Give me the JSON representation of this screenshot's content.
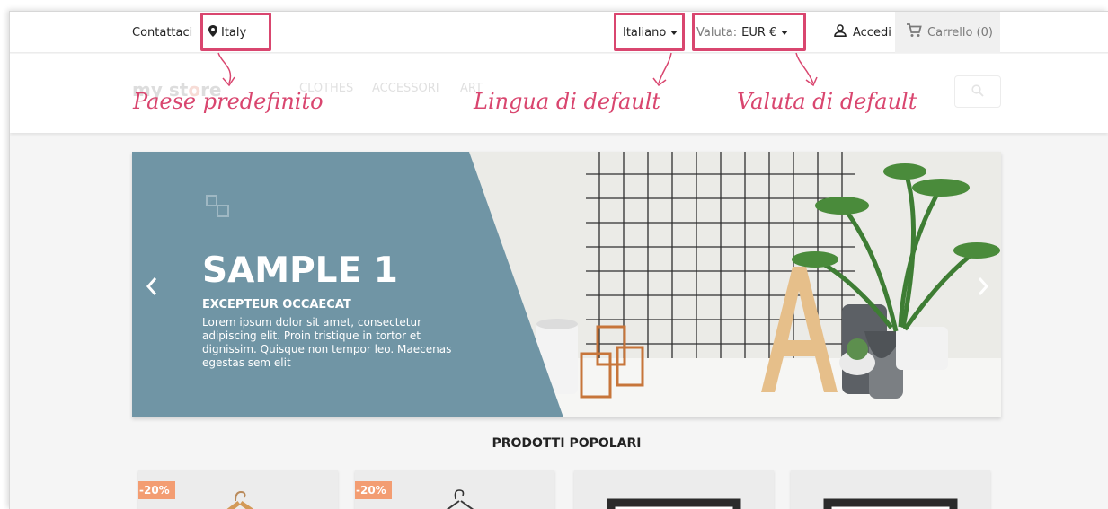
{
  "topbar": {
    "contact_label": "Contattaci",
    "country": "Italy",
    "language": "Italiano",
    "currency_label": "Valuta:",
    "currency_value": "EUR €",
    "signin_label": "Accedi",
    "cart_label": "Carrello (0)"
  },
  "header": {
    "logo_text_a": "my st",
    "logo_text_b": "o",
    "logo_text_c": "re",
    "menu": [
      "CLOTHES",
      "ACCESSORI",
      "ART"
    ]
  },
  "annotations": {
    "country": "Paese predefinito",
    "language": "Lingua di default",
    "currency": "Valuta di default"
  },
  "slider": {
    "title": "SAMPLE 1",
    "subtitle": "EXCEPTEUR OCCAECAT",
    "body": "Lorem ipsum dolor sit amet, consectetur adipiscing elit. Proin tristique in tortor et dignissim. Quisque non tempor leo. Maecenas egestas sem elit"
  },
  "section_title": "PRODOTTI POPOLARI",
  "products": [
    {
      "flag": "-20%"
    },
    {
      "flag": "-20%"
    },
    {
      "flag": ""
    },
    {
      "flag": ""
    }
  ],
  "colors": {
    "highlight": "#d9466f",
    "slide_panel": "#7095a5",
    "discount": "#f39d72"
  }
}
